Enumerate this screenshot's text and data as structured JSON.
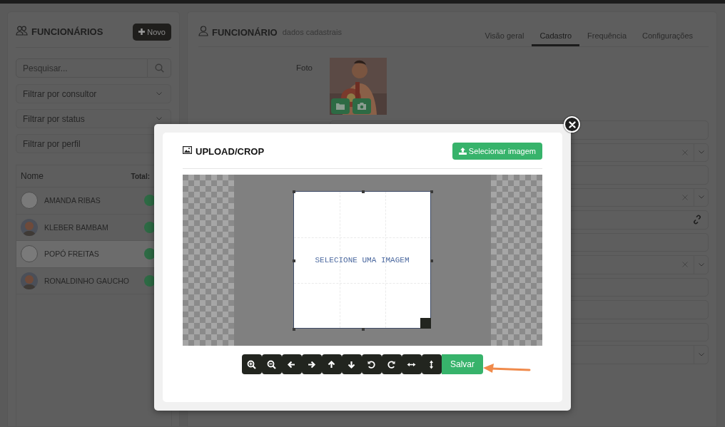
{
  "left_panel": {
    "title": "FUNCIONÁRIOS",
    "new_button": "Novo",
    "search": {
      "placeholder": "Pesquisar..."
    },
    "filters": [
      {
        "label": "Filtrar por consultor"
      },
      {
        "label": "Filtrar por status"
      },
      {
        "label": "Filtrar por perfil"
      }
    ],
    "table": {
      "columns": [
        "Nome",
        "Total:"
      ],
      "rows": [
        {
          "name": "AMANDA RIBAS",
          "kind": "placeholder",
          "selected": false
        },
        {
          "name": "KLEBER BAMBAM",
          "selected": false
        },
        {
          "name": "POPÓ FREITAS",
          "kind": "placeholder",
          "selected": true
        },
        {
          "name": "RONALDINHO GAUCHO",
          "selected": false
        }
      ]
    }
  },
  "right_panel": {
    "title": "FUNCIONÁRIO",
    "subtitle": "dados cadastrais",
    "tabs": [
      {
        "label": "Visão geral",
        "selected": false
      },
      {
        "label": "Cadastro",
        "selected": true
      },
      {
        "label": "Frequência",
        "selected": false
      },
      {
        "label": "Configurações",
        "selected": false
      }
    ],
    "photo_label": "Foto",
    "fields": [
      {
        "kind": "input"
      },
      {
        "kind": "select-clear"
      },
      {
        "kind": "input"
      },
      {
        "kind": "select-clear"
      },
      {
        "kind": "link"
      },
      {
        "kind": "input"
      },
      {
        "kind": "select-clear"
      },
      {
        "kind": "input"
      },
      {
        "kind": "input"
      },
      {
        "kind": "input"
      },
      {
        "kind": "select"
      }
    ]
  },
  "modal": {
    "title": "UPLOAD/CROP",
    "select_button": "Selecionar imagem",
    "crop_placeholder": "SELECIONE UMA IMAGEM",
    "toolbar": [
      {
        "kind": "zoom-in"
      },
      {
        "kind": "zoom-out"
      },
      {
        "kind": "left"
      },
      {
        "kind": "right"
      },
      {
        "kind": "up"
      },
      {
        "kind": "down"
      },
      {
        "kind": "rotate-left"
      },
      {
        "kind": "rotate-right"
      },
      {
        "kind": "flip-h"
      },
      {
        "kind": "flip-v"
      }
    ],
    "save_button": "Salvar"
  }
}
